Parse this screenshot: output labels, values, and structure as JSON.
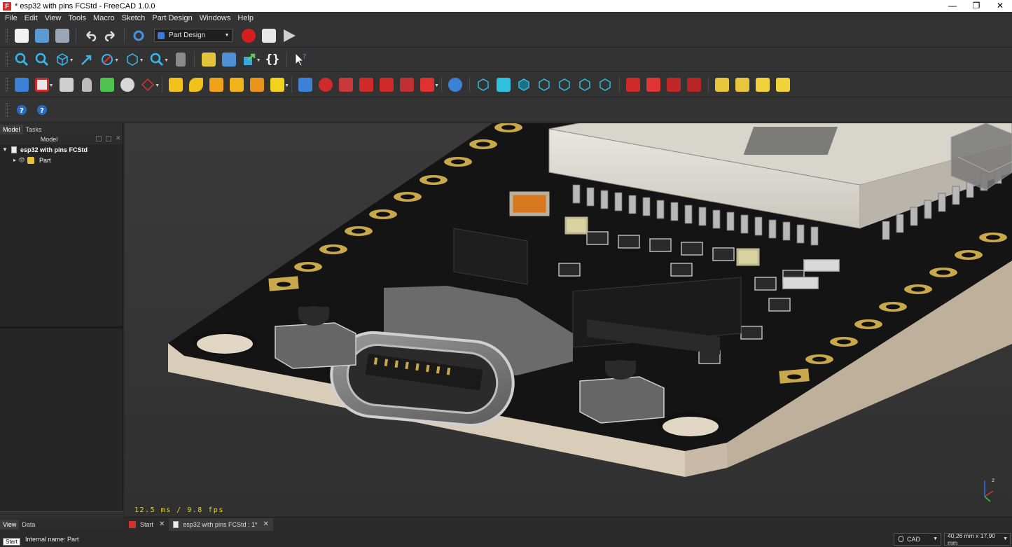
{
  "window": {
    "title": "* esp32 with pins FCStd - FreeCAD 1.0.0",
    "app_icon": "F",
    "minimize": "—",
    "restore": "❐",
    "close": "✕"
  },
  "menu": [
    "File",
    "Edit",
    "View",
    "Tools",
    "Macro",
    "Sketch",
    "Part Design",
    "Windows",
    "Help"
  ],
  "workbench": {
    "selected": "Part Design"
  },
  "left_panel": {
    "tabs": [
      "Model",
      "Tasks"
    ],
    "header": "Model",
    "tree": [
      {
        "label": "esp32 with pins FCStd",
        "expanded": true
      },
      {
        "label": "Part",
        "expanded": false
      }
    ],
    "bottom_tabs": [
      "View",
      "Data"
    ]
  },
  "view": {
    "fps_text": "12.5 ms / 9.8 fps",
    "background": "#353535",
    "board_color": "#141414",
    "pad_color": "#c8a84a"
  },
  "doc_tabs": [
    {
      "label": "Start",
      "active": false
    },
    {
      "label": "esp32 with pins FCStd : 1*",
      "active": true
    }
  ],
  "status": {
    "text": "Internal name: Part",
    "tooltip": "Start",
    "nav_style": "CAD",
    "dimensions": "40,26 mm x 17,90 mm"
  }
}
